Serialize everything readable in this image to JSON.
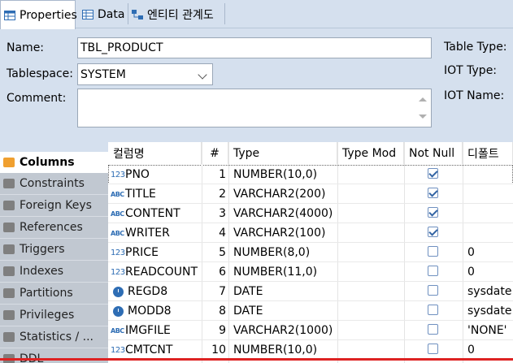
{
  "tabs": [
    {
      "label": "Properties",
      "icon": "table-icon",
      "active": true
    },
    {
      "label": "Data",
      "icon": "data-grid-icon",
      "active": false
    },
    {
      "label": "엔티티 관계도",
      "icon": "er-diagram-icon",
      "active": false
    }
  ],
  "properties": {
    "name_label": "Name:",
    "name_value": "TBL_PRODUCT",
    "tablespace_label": "Tablespace:",
    "tablespace_value": "SYSTEM",
    "comment_label": "Comment:",
    "comment_value": "",
    "table_type_label": "Table Type:",
    "iot_type_label": "IOT Type:",
    "iot_name_label": "IOT Name:"
  },
  "sidebar": {
    "items": [
      {
        "label": "Columns",
        "icon": "columns-icon",
        "active": true
      },
      {
        "label": "Constraints",
        "icon": "constraints-icon",
        "active": false
      },
      {
        "label": "Foreign Keys",
        "icon": "folder-icon",
        "active": false
      },
      {
        "label": "References",
        "icon": "folder-icon",
        "active": false
      },
      {
        "label": "Triggers",
        "icon": "folder-icon",
        "active": false
      },
      {
        "label": "Indexes",
        "icon": "folder-icon",
        "active": false
      },
      {
        "label": "Partitions",
        "icon": "folder-icon",
        "active": false
      },
      {
        "label": "Privileges",
        "icon": "key-icon",
        "active": false
      },
      {
        "label": "Statistics / ...",
        "icon": "info-icon",
        "active": false
      },
      {
        "label": "DDL",
        "icon": "folder-icon",
        "active": false
      }
    ]
  },
  "columns_table": {
    "headers": [
      "컬럼명",
      "#",
      "Type",
      "Type Mod",
      "Not Null",
      "디폴트"
    ],
    "rows": [
      {
        "icon": "123",
        "name": "PNO",
        "num": "1",
        "type": "NUMBER(10,0)",
        "mod": "",
        "not_null": true,
        "default": ""
      },
      {
        "icon": "ABC",
        "name": "TITLE",
        "num": "2",
        "type": "VARCHAR2(200)",
        "mod": "",
        "not_null": true,
        "default": ""
      },
      {
        "icon": "ABC",
        "name": "CONTENT",
        "num": "3",
        "type": "VARCHAR2(4000)",
        "mod": "",
        "not_null": true,
        "default": ""
      },
      {
        "icon": "ABC",
        "name": "WRITER",
        "num": "4",
        "type": "VARCHAR2(100)",
        "mod": "",
        "not_null": true,
        "default": ""
      },
      {
        "icon": "123",
        "name": "PRICE",
        "num": "5",
        "type": "NUMBER(8,0)",
        "mod": "",
        "not_null": false,
        "default": "0"
      },
      {
        "icon": "123",
        "name": "READCOUNT",
        "num": "6",
        "type": "NUMBER(11,0)",
        "mod": "",
        "not_null": false,
        "default": "0"
      },
      {
        "icon": "clock",
        "name": "REGD8",
        "num": "7",
        "type": "DATE",
        "mod": "",
        "not_null": false,
        "default": "sysdate"
      },
      {
        "icon": "clock",
        "name": "MODD8",
        "num": "8",
        "type": "DATE",
        "mod": "",
        "not_null": false,
        "default": "sysdate"
      },
      {
        "icon": "ABC",
        "name": "IMGFILE",
        "num": "9",
        "type": "VARCHAR2(1000)",
        "mod": "",
        "not_null": false,
        "default": "'NONE'"
      },
      {
        "icon": "123",
        "name": "CMTCNT",
        "num": "10",
        "type": "NUMBER(10,0)",
        "mod": "",
        "not_null": false,
        "default": "0"
      }
    ]
  },
  "colors": {
    "accent": "#2e6db4",
    "error_line": "#dd2222",
    "panel_bg": "#d5e0ee"
  }
}
